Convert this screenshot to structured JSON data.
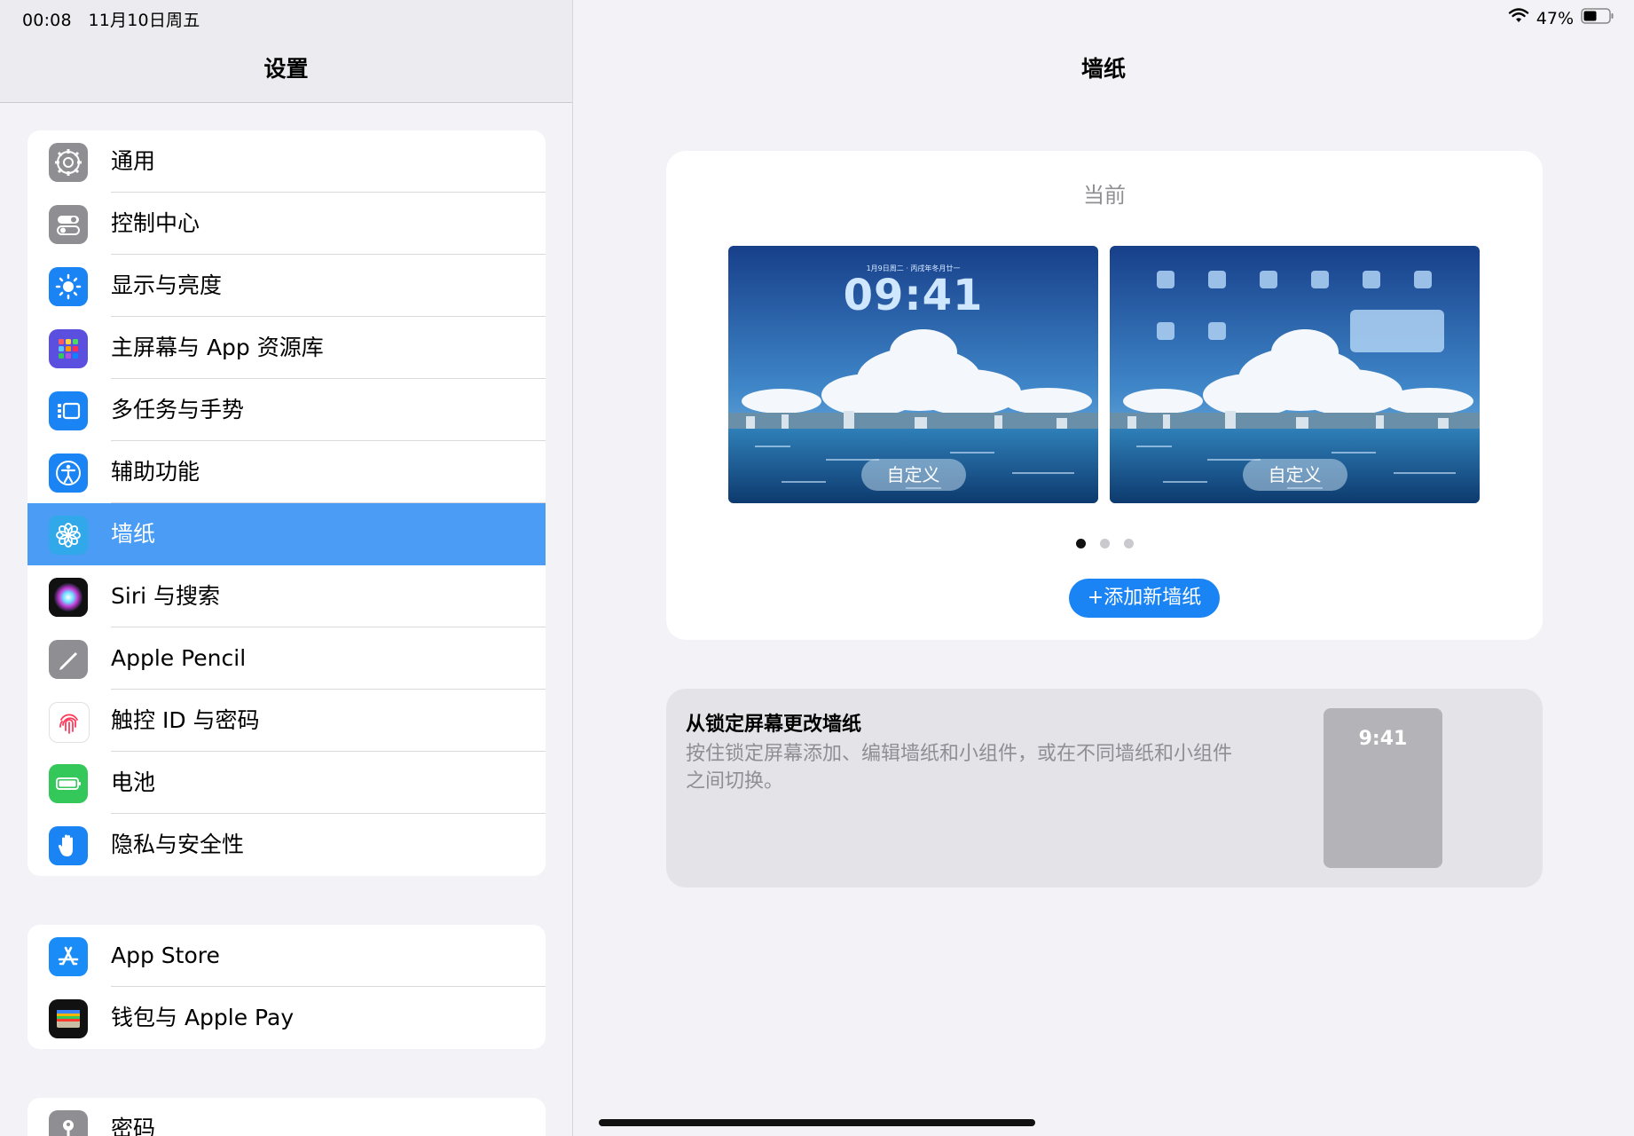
{
  "status": {
    "time": "00:08",
    "date": "11月10日周五",
    "battery": "47%"
  },
  "sidebar": {
    "title": "设置",
    "groups": [
      [
        {
          "label": "通用",
          "icon": "gear-icon",
          "color": "#8e8e93"
        },
        {
          "label": "控制中心",
          "icon": "switches-icon",
          "color": "#8e8e93"
        },
        {
          "label": "显示与亮度",
          "icon": "sun-icon",
          "color": "#1a84f5"
        },
        {
          "label": "主屏幕与 App 资源库",
          "icon": "app-grid-icon",
          "color": "#5b4fe0"
        },
        {
          "label": "多任务与手势",
          "icon": "multitask-icon",
          "color": "#1a84f5"
        },
        {
          "label": "辅助功能",
          "icon": "accessibility-icon",
          "color": "#1a84f5"
        },
        {
          "label": "墙纸",
          "icon": "flower-icon",
          "color": "#31a8e9",
          "selected": true
        },
        {
          "label": "Siri 与搜索",
          "icon": "siri-icon",
          "color": "#222222"
        },
        {
          "label": "Apple Pencil",
          "icon": "pencil-icon",
          "color": "#8e8e93"
        },
        {
          "label": "触控 ID 与密码",
          "icon": "fingerprint-icon",
          "color": "#ffffff"
        },
        {
          "label": "电池",
          "icon": "battery-icon",
          "color": "#34c759"
        },
        {
          "label": "隐私与安全性",
          "icon": "hand-icon",
          "color": "#1a84f5"
        }
      ],
      [
        {
          "label": "App Store",
          "icon": "appstore-icon",
          "color": "#1a8cf7"
        },
        {
          "label": "钱包与 Apple Pay",
          "icon": "wallet-icon",
          "color": "#111111"
        }
      ],
      [
        {
          "label": "密码",
          "icon": "key-icon",
          "color": "#8e8e93"
        }
      ]
    ]
  },
  "detail": {
    "title": "墙纸",
    "current_label": "当前",
    "lock_preview": {
      "time": "09:41",
      "date": "1月9日周二 · 丙戌年冬月廿一",
      "button": "自定义"
    },
    "home_preview": {
      "button": "自定义"
    },
    "pages": {
      "count": 3,
      "active": 1
    },
    "add_button": "+添加新墙纸",
    "lock_card": {
      "title": "从锁定屏幕更改墙纸",
      "description": "按住锁定屏幕添加、编辑墙纸和小组件，或在不同墙纸和小组件之间切换。",
      "thumb_time": "9:41"
    }
  }
}
